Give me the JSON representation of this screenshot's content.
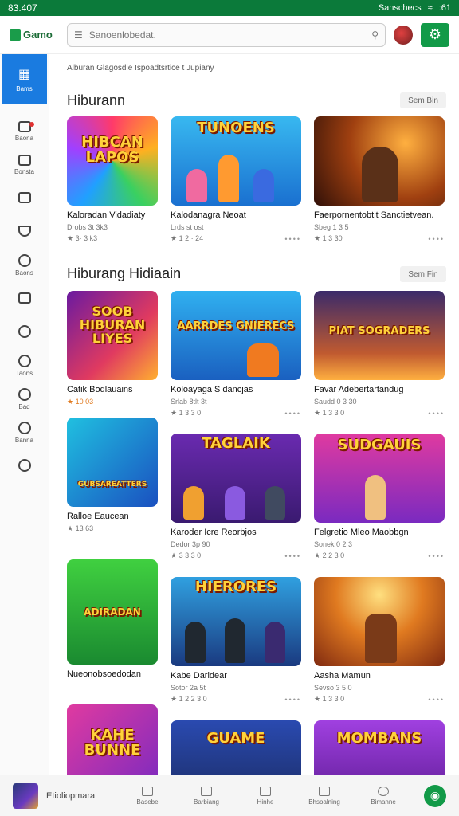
{
  "status": {
    "time": "83.407",
    "carrier": "Sanschecs",
    "battery": ":61"
  },
  "header": {
    "logo": "Gamo",
    "search_placeholder": "Sanoenlobedat."
  },
  "sidebar": {
    "active_label": "Bams",
    "items": [
      {
        "label": "Baona",
        "icon": "home-icon"
      },
      {
        "label": "Bonsta",
        "icon": "book-icon"
      },
      {
        "label": "",
        "icon": "chat-icon"
      },
      {
        "label": "",
        "icon": "heart-icon"
      },
      {
        "label": "Baons",
        "icon": "message-icon"
      },
      {
        "label": "",
        "icon": "list-icon"
      },
      {
        "label": "",
        "icon": "circle-icon"
      },
      {
        "label": "Taons",
        "icon": "clock-icon"
      },
      {
        "label": "Bad",
        "icon": "bubble-icon"
      },
      {
        "label": "Banna",
        "icon": "check-icon"
      },
      {
        "label": "",
        "icon": "ring-icon"
      }
    ]
  },
  "main": {
    "breadcrumb": "Alburan  Glagosdie Ispoadtsrtice t  Jupiany",
    "sections": [
      {
        "title": "Hiburann",
        "see_all": "Sem  Bin"
      },
      {
        "title": "Hiburang Hidiaain",
        "see_all": "Sem  Fin"
      }
    ],
    "cards": [
      {
        "art": "HIBCAN LAPOS",
        "title": "Kaloradan Vidadiaty",
        "meta": "Drobs 3t 3k3",
        "rating": "★ 3· 3 k3"
      },
      {
        "art": "TUNOENS",
        "title": "Kalodanagra Neoat",
        "meta": "Lrds st ost",
        "rating": "★ 1 2 · 24"
      },
      {
        "art": "",
        "title": "Faerpornentobtit Sanctietvean.",
        "meta": "Sbeg 1 3 5",
        "rating": "★ 1 3 30"
      },
      {
        "art": "SOOB HIBURAN LIYES",
        "title": "Catik Bodlauains",
        "meta": "",
        "rating": "★ 10 03"
      },
      {
        "art": "AARRDES GNIERECS",
        "title": "Koloayaga S dancjas",
        "meta": "Srlab 8tlt 3t",
        "rating": "★ 1 3 3 0"
      },
      {
        "art": "PIAT SOGRADERS",
        "title": "Favar Adebertartandug",
        "meta": "Saudd 0 3 30",
        "rating": "★ 1 3 3 0"
      },
      {
        "art": "GUBSAREATTERS",
        "title": "Ralloe Eaucean",
        "meta": "",
        "rating": "★ 13 63"
      },
      {
        "art": "TAGLAIK",
        "title": "Karoder Icre Reorbjos",
        "meta": "Dedor 3p 90",
        "rating": "★ 3 3 3 0"
      },
      {
        "art": "SUDGAUIS",
        "title": "Felgretio Mleo Maobbgn",
        "meta": "Sonek 0 2 3",
        "rating": "★ 2 2 3 0"
      },
      {
        "art": "ADIRADAN",
        "title": "Nueonobsoedodan",
        "meta": "",
        "rating": ""
      },
      {
        "art": "HIERORES",
        "title": "Kabe Darldear",
        "meta": "Sotor 2a 5t",
        "rating": "★ 1 2 2 3 0"
      },
      {
        "art": "",
        "title": "Aasha Mamun",
        "meta": "Sevso 3 5 0",
        "rating": "★ 1 3 3 0"
      },
      {
        "art": "KAHE BUNNE",
        "title": "",
        "meta": "",
        "rating": ""
      },
      {
        "art": "GUAME",
        "title": "",
        "meta": "",
        "rating": ""
      },
      {
        "art": "MOMBANS",
        "title": "",
        "meta": "",
        "rating": ""
      }
    ]
  },
  "bottombar": {
    "now_playing": "Etioliopmara",
    "items": [
      "Basebe",
      "Barbiang",
      "Hinhe",
      "Bhsoalning",
      "Bimanne"
    ]
  }
}
